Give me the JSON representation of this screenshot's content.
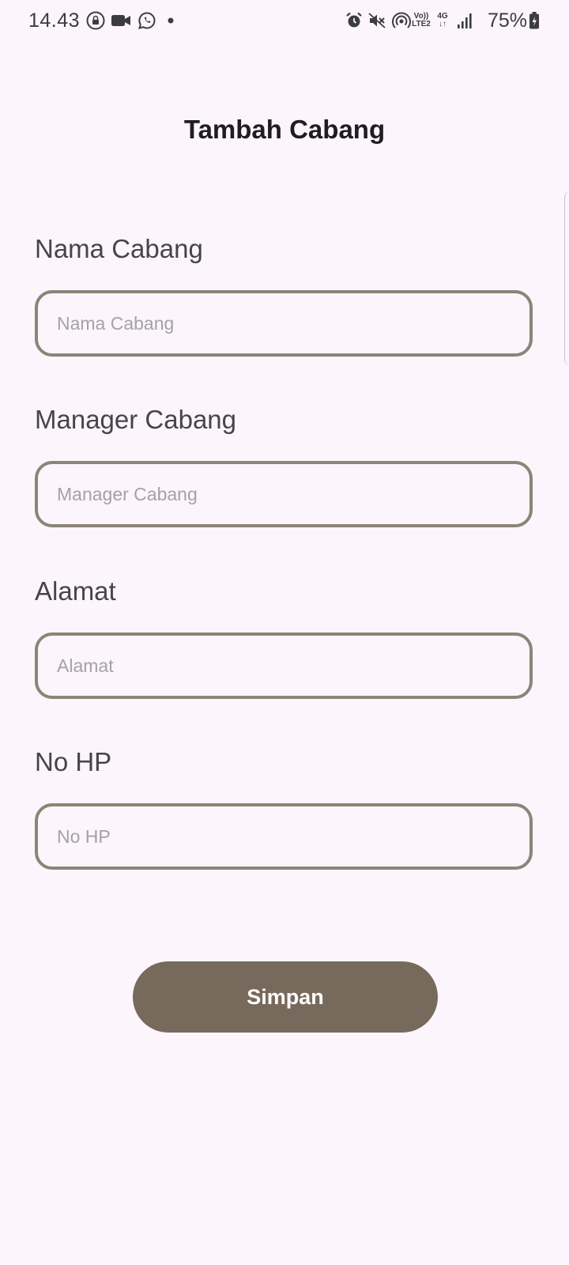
{
  "status_bar": {
    "time": "14.43",
    "battery": "75%",
    "volte": [
      "Vo))",
      "LTE2"
    ],
    "network": [
      "4G",
      "↓↑"
    ],
    "icons": [
      "lock-icon",
      "video-icon",
      "whatsapp-icon",
      "dot-icon",
      "alarm-icon",
      "mute-icon",
      "hotspot-icon",
      "volte-icon",
      "network-4g-icon",
      "signal-icon",
      "battery-icon"
    ]
  },
  "header": {
    "title": "Tambah Cabang"
  },
  "form": {
    "fields": [
      {
        "label": "Nama Cabang",
        "placeholder": "Nama Cabang",
        "value": ""
      },
      {
        "label": "Manager Cabang",
        "placeholder": "Manager Cabang",
        "value": ""
      },
      {
        "label": "Alamat",
        "placeholder": "Alamat",
        "value": ""
      },
      {
        "label": "No HP",
        "placeholder": "No HP",
        "value": ""
      }
    ],
    "submit_label": "Simpan"
  },
  "colors": {
    "background": "#fcf5fc",
    "field_border": "#8d8477",
    "button": "#776a5c",
    "button_text": "#ffffff",
    "title": "#1f1d22",
    "placeholder": "#a4a2a7"
  }
}
